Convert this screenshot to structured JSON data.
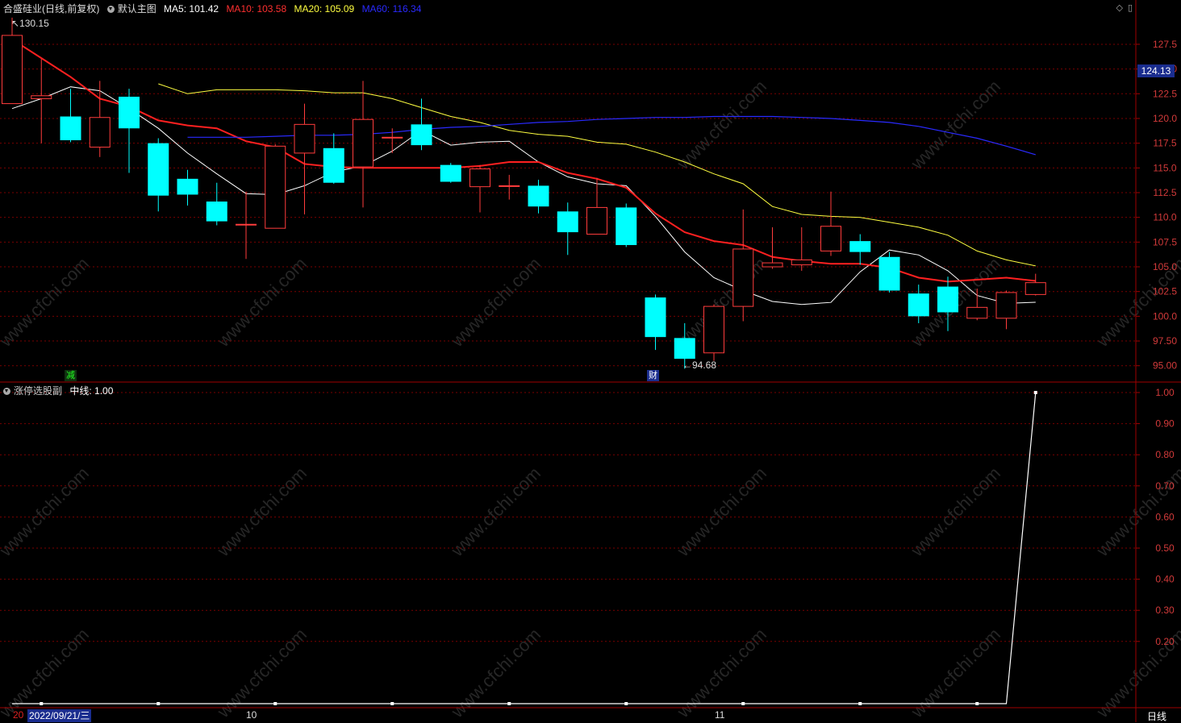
{
  "header": {
    "stock_name": "合盛硅业",
    "period": "(日线,前复权)",
    "main_chart_label": "默认主图",
    "ma5_label": "MA5: 101.42",
    "ma10_label": "MA10: 103.58",
    "ma20_label": "MA20: 105.09",
    "ma60_label": "MA60: 116.34"
  },
  "sub_header": {
    "indicator_label": "涨停选股副",
    "midline_label": "中线: 1.00"
  },
  "price_tag": "124.13",
  "high_marker": "130.15",
  "low_marker": "94.68",
  "event_tags": {
    "reduce": "减",
    "finance": "财"
  },
  "xaxis": {
    "left_clip": "20",
    "date_tag": "2022/09/21/三",
    "oct": "10",
    "nov": "11",
    "period_button": "日线"
  },
  "watermark": "www.cfchi.com",
  "colors": {
    "up": "#ff3c3c",
    "down": "#00ffff",
    "ma5": "#ffffff",
    "ma10": "#ff2020",
    "ma20": "#ffff40",
    "ma60": "#2a2aff",
    "grid": "#7a0000",
    "frame": "#a00000"
  },
  "chart_data": [
    {
      "type": "candlestick",
      "title": "合盛硅业 (日线,前复权)",
      "y_ticks": [
        "130.15",
        "127.5",
        "125.0",
        "122.5",
        "120.0",
        "117.5",
        "115.0",
        "112.5",
        "110.0",
        "107.5",
        "105.0",
        "102.5",
        "100.0",
        "97.50",
        "95.00"
      ],
      "ylim": [
        94.0,
        131.0
      ],
      "candles": [
        {
          "o": 121.5,
          "h": 130.2,
          "l": 121.5,
          "c": 128.4
        },
        {
          "o": 122.0,
          "h": 126.0,
          "l": 117.5,
          "c": 122.3
        },
        {
          "o": 120.2,
          "h": 123.0,
          "l": 117.6,
          "c": 117.8
        },
        {
          "o": 117.1,
          "h": 123.8,
          "l": 116.1,
          "c": 120.1
        },
        {
          "o": 122.2,
          "h": 123.0,
          "l": 114.5,
          "c": 119.0
        },
        {
          "o": 117.5,
          "h": 118.0,
          "l": 110.6,
          "c": 112.2
        },
        {
          "o": 113.9,
          "h": 114.8,
          "l": 111.2,
          "c": 112.3
        },
        {
          "o": 111.6,
          "h": 113.5,
          "l": 109.2,
          "c": 109.6
        },
        {
          "o": 109.3,
          "h": 112.6,
          "l": 105.8,
          "c": 109.3
        },
        {
          "o": 108.9,
          "h": 117.4,
          "l": 108.9,
          "c": 117.2
        },
        {
          "o": 116.5,
          "h": 121.5,
          "l": 110.3,
          "c": 119.4
        },
        {
          "o": 117.0,
          "h": 118.5,
          "l": 113.4,
          "c": 113.5
        },
        {
          "o": 115.1,
          "h": 123.8,
          "l": 111.0,
          "c": 119.9
        },
        {
          "o": 118.1,
          "h": 119.0,
          "l": 116.5,
          "c": 118.1
        },
        {
          "o": 119.4,
          "h": 122.0,
          "l": 116.8,
          "c": 117.3
        },
        {
          "o": 115.3,
          "h": 115.5,
          "l": 113.5,
          "c": 113.6
        },
        {
          "o": 113.1,
          "h": 115.3,
          "l": 110.5,
          "c": 114.9
        },
        {
          "o": 113.2,
          "h": 114.3,
          "l": 111.8,
          "c": 113.2
        },
        {
          "o": 113.2,
          "h": 113.8,
          "l": 110.4,
          "c": 111.1
        },
        {
          "o": 110.6,
          "h": 111.5,
          "l": 106.2,
          "c": 108.5
        },
        {
          "o": 108.3,
          "h": 114.0,
          "l": 108.3,
          "c": 111.0
        },
        {
          "o": 111.0,
          "h": 111.4,
          "l": 107.0,
          "c": 107.2
        },
        {
          "o": 101.9,
          "h": 102.2,
          "l": 96.6,
          "c": 97.9
        },
        {
          "o": 97.8,
          "h": 99.3,
          "l": 94.7,
          "c": 95.7
        },
        {
          "o": 96.3,
          "h": 101.2,
          "l": 95.5,
          "c": 101.0
        },
        {
          "o": 101.0,
          "h": 110.8,
          "l": 99.5,
          "c": 106.8
        },
        {
          "o": 105.0,
          "h": 109.0,
          "l": 104.8,
          "c": 105.4
        },
        {
          "o": 105.2,
          "h": 109.0,
          "l": 104.6,
          "c": 105.7
        },
        {
          "o": 106.6,
          "h": 112.6,
          "l": 106.1,
          "c": 109.1
        },
        {
          "o": 107.6,
          "h": 108.3,
          "l": 105.2,
          "c": 106.5
        },
        {
          "o": 106.0,
          "h": 106.5,
          "l": 102.4,
          "c": 102.6
        },
        {
          "o": 102.3,
          "h": 103.2,
          "l": 99.3,
          "c": 100.0
        },
        {
          "o": 103.0,
          "h": 104.0,
          "l": 98.5,
          "c": 100.4
        },
        {
          "o": 99.8,
          "h": 102.8,
          "l": 99.6,
          "c": 100.9
        },
        {
          "o": 99.8,
          "h": 102.6,
          "l": 98.7,
          "c": 102.4
        },
        {
          "o": 102.2,
          "h": 104.3,
          "l": 102.1,
          "c": 103.4
        }
      ],
      "series": [
        {
          "name": "MA5",
          "values": [
            121.0,
            122.0,
            123.2,
            122.8,
            121.0,
            119.0,
            116.5,
            114.4,
            112.4,
            112.3,
            113.2,
            114.6,
            115.2,
            116.7,
            118.8,
            117.3,
            117.6,
            117.7,
            115.6,
            114.1,
            113.4,
            113.2,
            110.1,
            106.5,
            103.9,
            102.6,
            101.5,
            101.2,
            101.4,
            104.5,
            106.7,
            106.2,
            104.6,
            102.1,
            101.3,
            101.42
          ]
        },
        {
          "name": "MA10",
          "values": [
            128.0,
            126.1,
            124.2,
            122.0,
            121.2,
            119.8,
            119.3,
            119.0,
            117.7,
            117.1,
            115.4,
            115.1,
            115.0,
            115.0,
            115.0,
            115.0,
            115.2,
            115.6,
            115.6,
            114.5,
            113.9,
            113.0,
            110.4,
            108.5,
            107.6,
            107.2,
            106.0,
            105.6,
            105.3,
            105.3,
            104.9,
            103.9,
            103.5,
            103.7,
            103.9,
            103.58
          ]
        },
        {
          "name": "MA20",
          "values": [
            123.5,
            122.5,
            122.9,
            122.9,
            122.9,
            122.8,
            122.6,
            122.6,
            122.0,
            121.1,
            120.2,
            119.6,
            118.8,
            118.4,
            118.2,
            117.6,
            117.4,
            116.6,
            115.6,
            114.4,
            113.4,
            111.1,
            110.3,
            110.1,
            110.0,
            109.5,
            109.0,
            108.2,
            106.6,
            105.7,
            105.09
          ]
        },
        {
          "name": "MA60",
          "values": [
            118.1,
            118.1,
            118.1,
            118.2,
            118.3,
            118.3,
            118.4,
            118.6,
            118.9,
            119.1,
            119.2,
            119.4,
            119.6,
            119.7,
            119.9,
            120.0,
            120.1,
            120.1,
            120.2,
            120.2,
            120.2,
            120.1,
            120.0,
            119.8,
            119.6,
            119.2,
            118.6,
            118.0,
            117.2,
            116.34
          ]
        }
      ]
    },
    {
      "type": "line",
      "title": "涨停选股副",
      "y_ticks": [
        "1.00",
        "0.90",
        "0.80",
        "0.70",
        "0.60",
        "0.50",
        "0.40",
        "0.30",
        "0.20"
      ],
      "ylim": [
        0,
        1.0
      ],
      "series": [
        {
          "name": "中线",
          "values": [
            0,
            0,
            0,
            0,
            0,
            0,
            0,
            0,
            0,
            0,
            0,
            0,
            0,
            0,
            0,
            0,
            0,
            0,
            0,
            0,
            0,
            0,
            0,
            0,
            0,
            0,
            0,
            0,
            0,
            0,
            0,
            0,
            0,
            0,
            0,
            1.0
          ]
        }
      ]
    }
  ]
}
